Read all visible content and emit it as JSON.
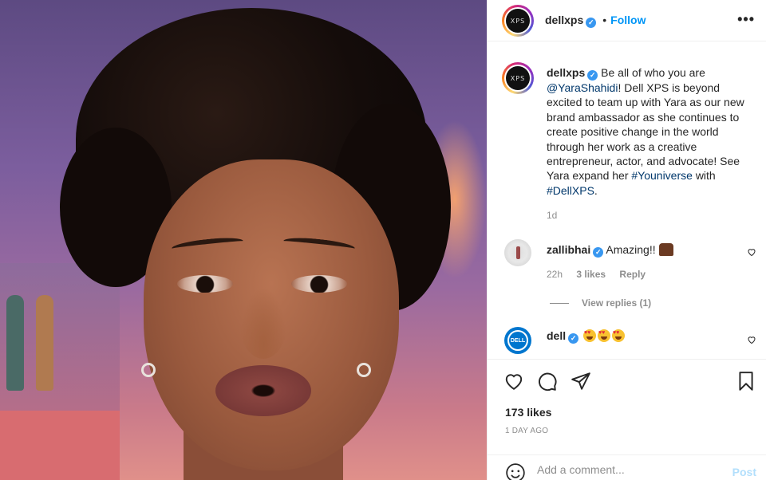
{
  "post": {
    "username": "dellxps",
    "avatar_text": "XPS",
    "follow_label": "Follow",
    "separator": "•",
    "more_label": "•••",
    "caption": {
      "username": "dellxps",
      "part1": "Be all of who you are",
      "mention": "@YaraShahidi",
      "part2": "! Dell XPS is beyond excited to team up with Yara as our new brand ambassador as she continues to create positive change in the world through her work as a creative entrepreneur, actor, and advocate! See Yara expand her",
      "hashtag1": "#Youniverse",
      "part3": "with",
      "hashtag2": "#DellXPS",
      "part4": ".",
      "time": "1d"
    },
    "comments": [
      {
        "username": "zallibhai",
        "text": "Amazing!!",
        "time": "22h",
        "likes": "3 likes",
        "reply_label": "Reply",
        "view_replies": "View replies (1)"
      },
      {
        "username": "dell",
        "avatar_text": "DELL"
      }
    ],
    "likes": "173 likes",
    "posted_ago": "1 DAY AGO",
    "comment_placeholder": "Add a comment...",
    "post_label": "Post",
    "icons": {
      "like": "heart-icon",
      "comment": "comment-icon",
      "share": "share-icon",
      "save": "bookmark-icon",
      "emoji": "smiley-icon",
      "more": "more-icon"
    },
    "colors": {
      "follow": "#0095f6",
      "verified": "#3897f0",
      "link": "#00376b",
      "muted": "#8e8e8e",
      "post_disabled": "#b2dffc"
    }
  }
}
